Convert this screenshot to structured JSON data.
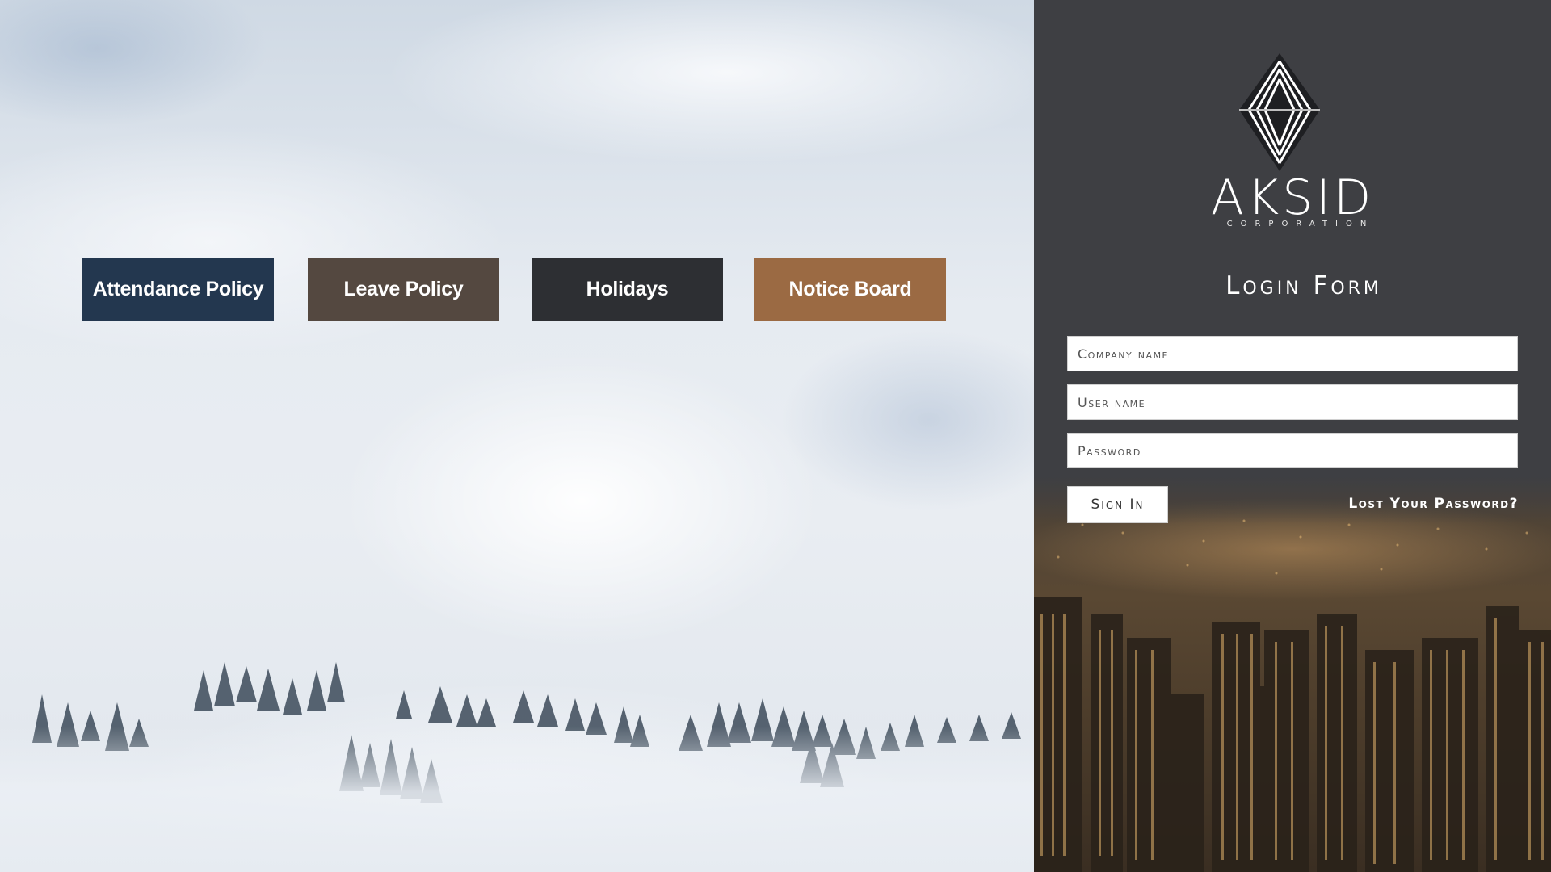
{
  "tiles": [
    {
      "label": "Attendance Policy",
      "color": "#23374f"
    },
    {
      "label": "Leave Policy",
      "color": "#544840"
    },
    {
      "label": "Holidays",
      "color": "#2d2f33"
    },
    {
      "label": "Notice Board",
      "color": "#9b6a43"
    }
  ],
  "login": {
    "brand": "AKSID",
    "brand_sub": "CORPORATION",
    "title": "Login Form",
    "company_placeholder": "Company name",
    "user_placeholder": "User name",
    "password_placeholder": "Password",
    "signin_label": "Sign In",
    "lost_password": "Lost Your Password?"
  },
  "colors": {
    "panel_bg": "#3e3f43",
    "field_bg": "#ffffff",
    "text_light": "#ffffff"
  }
}
